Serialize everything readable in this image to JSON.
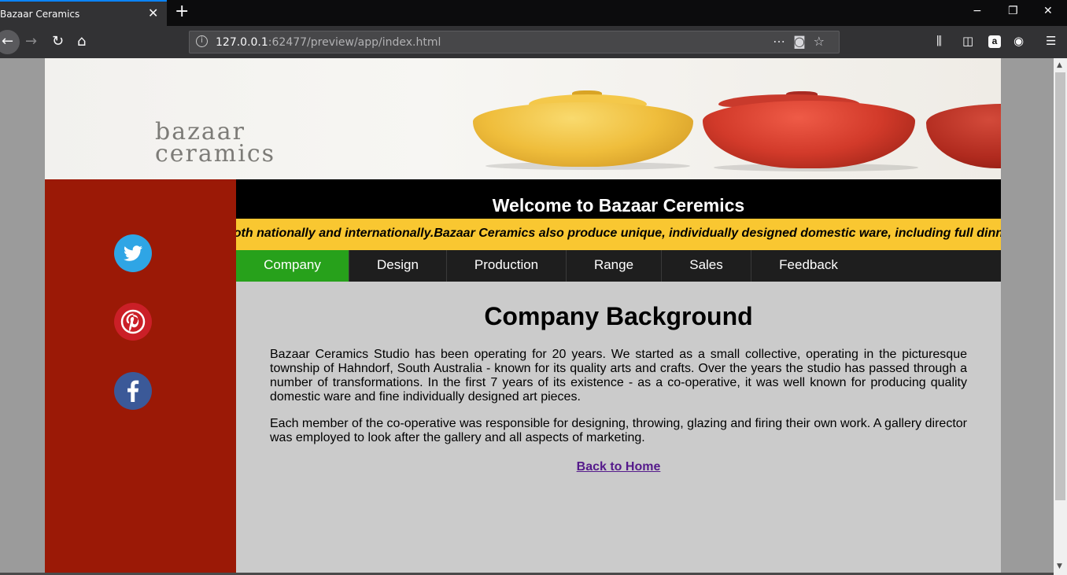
{
  "browser": {
    "tab_title": "Bazaar Ceramics",
    "tab_close": "✕",
    "new_tab": "+",
    "url_host": "127.0.0.1",
    "url_rest": ":62477/preview/app/index.html",
    "window_controls": [
      "−",
      "❐",
      "✕"
    ],
    "icons": [
      "back-icon",
      "forward-icon",
      "reload-icon",
      "home-icon",
      "info-icon",
      "page-actions-icon",
      "pocket-icon",
      "bookmark-star-icon",
      "library-icon",
      "sidebar-icon",
      "amazon-icon",
      "account-icon",
      "menu-icon"
    ]
  },
  "banner": {
    "brand_line1": "bazaar",
    "brand_line2": "ceramics"
  },
  "header": {
    "welcome": "Welcome to Bazaar Ceremics"
  },
  "marquee": {
    "text": "both nationally and internationally.Bazaar Ceramics also produce unique, individually designed domestic ware, including full dinner"
  },
  "menu": {
    "items": [
      {
        "label": "Company",
        "active": true
      },
      {
        "label": "Design",
        "active": false
      },
      {
        "label": "Production",
        "active": false
      },
      {
        "label": "Range",
        "active": false
      },
      {
        "label": "Sales",
        "active": false
      },
      {
        "label": "Feedback",
        "active": false
      }
    ]
  },
  "social": [
    "twitter-icon",
    "pinterest-icon",
    "facebook-icon"
  ],
  "content": {
    "heading": "Company Background",
    "paragraph1": "Bazaar Ceramics Studio has been operating for 20 years.  We started as a small collective, operating in the picturesque township of Hahndorf, South Australia - known for its quality arts and crafts.  Over the years the studio has passed through a number of transformations.  In the first 7 years of its existence - as a co-operative, it was well known for producing quality domestic ware and fine individually designed art pieces.",
    "paragraph2": "Each member of the co-operative was responsible for designing, throwing, glazing and firing their own work.  A gallery director was employed to look after the gallery and all aspects of marketing.",
    "back_link": "Back to Home"
  },
  "colors": {
    "sidebar": "#9b1906",
    "marquee": "#f9c731",
    "menu_active": "#27a11b",
    "menu_bg": "#1e1e1e",
    "content_bg": "#cbcbcb"
  }
}
